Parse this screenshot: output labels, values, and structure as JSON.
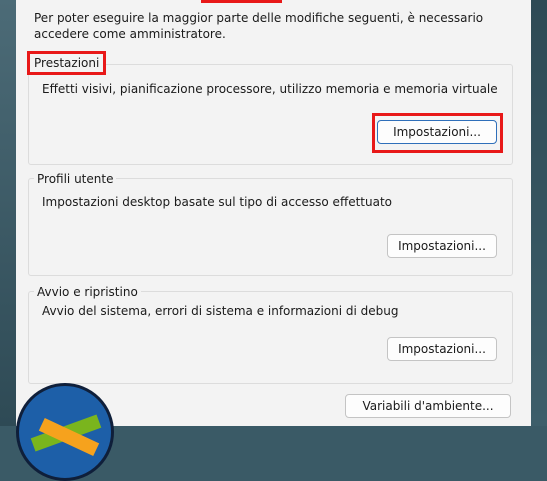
{
  "intro_text": "Per poter eseguire la maggior parte delle modifiche seguenti, è necessario accedere come amministratore.",
  "performance": {
    "title": "Prestazioni",
    "description": "Effetti visivi, pianificazione processore, utilizzo memoria e memoria virtuale",
    "button_label": "Impostazioni..."
  },
  "user_profiles": {
    "title": "Profili utente",
    "description": "Impostazioni desktop basate sul tipo di accesso effettuato",
    "button_label": "Impostazioni..."
  },
  "startup_recovery": {
    "title": "Avvio e ripristino",
    "description": "Avvio del sistema, errori di sistema e informazioni di debug",
    "button_label": "Impostazioni..."
  },
  "env_button_label": "Variabili d'ambiente...",
  "colors": {
    "highlight": "#e81818",
    "panel": "#f3f3f3",
    "accent_border": "#2f6fba"
  }
}
